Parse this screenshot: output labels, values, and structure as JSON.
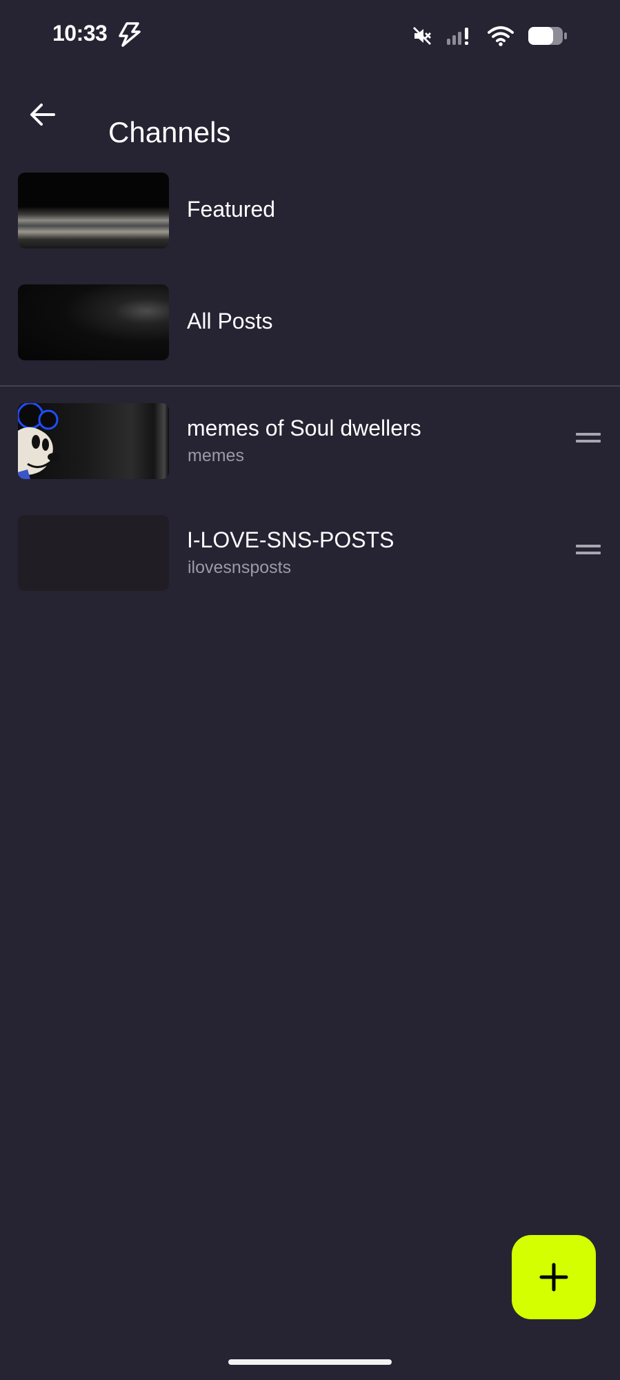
{
  "status_bar": {
    "time": "10:33",
    "icons": [
      "flash-icon",
      "mute-icon",
      "cell-signal-icon",
      "wifi-icon",
      "battery-icon"
    ]
  },
  "header": {
    "title": "Channels",
    "back_icon": "arrow-left-icon"
  },
  "pinned_channels": [
    {
      "title": "Featured"
    },
    {
      "title": "All Posts"
    }
  ],
  "channels": [
    {
      "title": "memes of Soul dwellers",
      "subtitle": "memes"
    },
    {
      "title": "I-LOVE-SNS-POSTS",
      "subtitle": "ilovesnsposts"
    }
  ],
  "fab": {
    "icon": "plus-icon"
  },
  "colors": {
    "background": "#262433",
    "accent": "#d4ff00",
    "text_primary": "#ffffff",
    "text_secondary": "#9d9aa6"
  }
}
